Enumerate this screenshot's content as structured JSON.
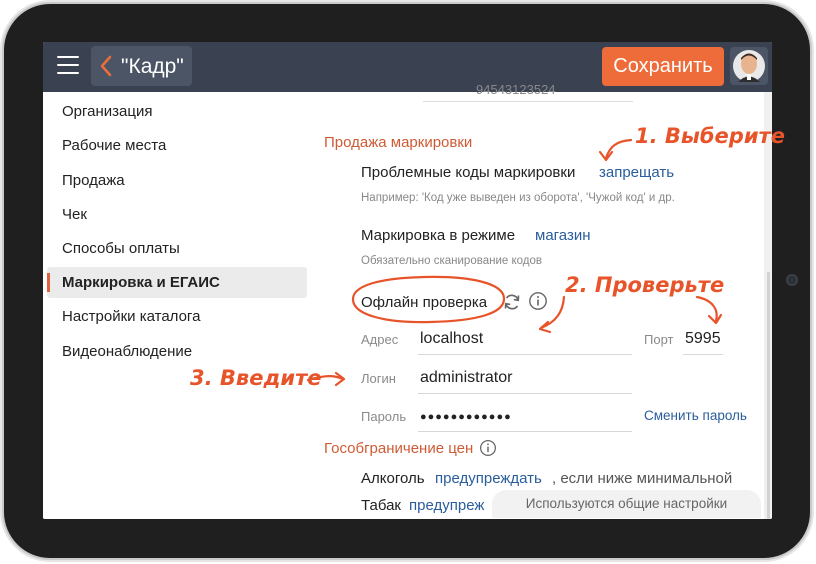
{
  "header": {
    "back_title": "\"Кадр\"",
    "save_label": "Сохранить"
  },
  "sidebar": {
    "items": [
      {
        "label": "Организация"
      },
      {
        "label": "Рабочие места"
      },
      {
        "label": "Продажа"
      },
      {
        "label": "Чек"
      },
      {
        "label": "Способы оплаты"
      },
      {
        "label": "Маркировка и ЕГАИС",
        "active": true
      },
      {
        "label": "Настройки каталога"
      },
      {
        "label": "Видеонаблюдение"
      }
    ]
  },
  "main": {
    "top_partial_value": "94543123524",
    "marking_section": "Продажа маркировки",
    "problem_codes_label": "Проблемные коды маркировки",
    "problem_codes_value": "запрещать",
    "problem_codes_hint": "Например: 'Код уже выведен из оборота', 'Чужой код' и др.",
    "mode_label": "Маркировка в режиме",
    "mode_value": "магазин",
    "mode_hint": "Обязательно сканирование кодов",
    "offline_label": "Офлайн проверка",
    "address_label": "Адрес",
    "address_value": "localhost",
    "port_label": "Порт",
    "port_value": "5995",
    "login_label": "Логин",
    "login_value": "administrator",
    "password_label": "Пароль",
    "password_value": "●●●●●●●●●●●●",
    "change_password": "Сменить пароль",
    "price_limit_section": "Гособграничение цен",
    "alcohol_label": "Алкоголь",
    "alcohol_value": "предупреждать",
    "alcohol_suffix": ", если ниже минимальной",
    "tobacco_label": "Табак",
    "tobacco_value": "предупреж",
    "toast": "Используются общие настройки"
  },
  "annotations": {
    "step1": "1. Выберите",
    "step2": "2. Проверьте",
    "step3": "3. Введите"
  },
  "colors": {
    "accent": "#ee6b3a",
    "header_bg": "#3a4252",
    "link": "#2a5d9c",
    "annotation": "#e8542a"
  }
}
